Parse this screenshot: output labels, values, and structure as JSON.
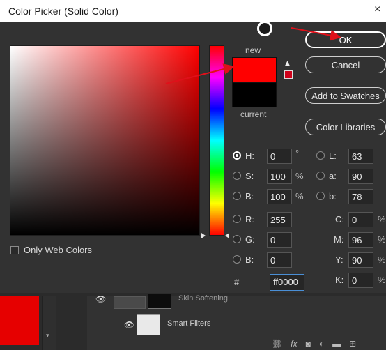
{
  "dialog": {
    "title": "Color Picker (Solid Color)",
    "close_glyph": "×"
  },
  "swatches": {
    "new_label": "new",
    "current_label": "current",
    "new_color": "#ff0000",
    "current_color": "#000000"
  },
  "buttons": {
    "ok": "OK",
    "cancel": "Cancel",
    "add_to_swatches": "Add to Swatches",
    "color_libraries": "Color Libraries"
  },
  "hsb": {
    "h_label": "H:",
    "h_value": "0",
    "h_unit": "°",
    "s_label": "S:",
    "s_value": "100",
    "s_unit": "%",
    "b_label": "B:",
    "b_value": "100",
    "b_unit": "%"
  },
  "lab": {
    "l_label": "L:",
    "l_value": "63",
    "a_label": "a:",
    "a_value": "90",
    "b_label": "b:",
    "b_value": "78"
  },
  "rgb": {
    "r_label": "R:",
    "r_value": "255",
    "g_label": "G:",
    "g_value": "0",
    "b_label": "B:",
    "b_value": "0"
  },
  "cmyk": {
    "c_label": "C:",
    "c_value": "0",
    "c_unit": "%",
    "m_label": "M:",
    "m_value": "96",
    "m_unit": "%",
    "y_label": "Y:",
    "y_value": "90",
    "y_unit": "%",
    "k_label": "K:",
    "k_value": "0",
    "k_unit": "%"
  },
  "hex": {
    "hash": "#",
    "value": "ff0000"
  },
  "options": {
    "only_web_colors": "Only Web Colors"
  },
  "layers_panel": {
    "layer_name": "Skin Softening",
    "smart_filters": "Smart Filters"
  },
  "colors": {
    "accent_red": "#e60000",
    "annotation_red": "#e0101a"
  }
}
